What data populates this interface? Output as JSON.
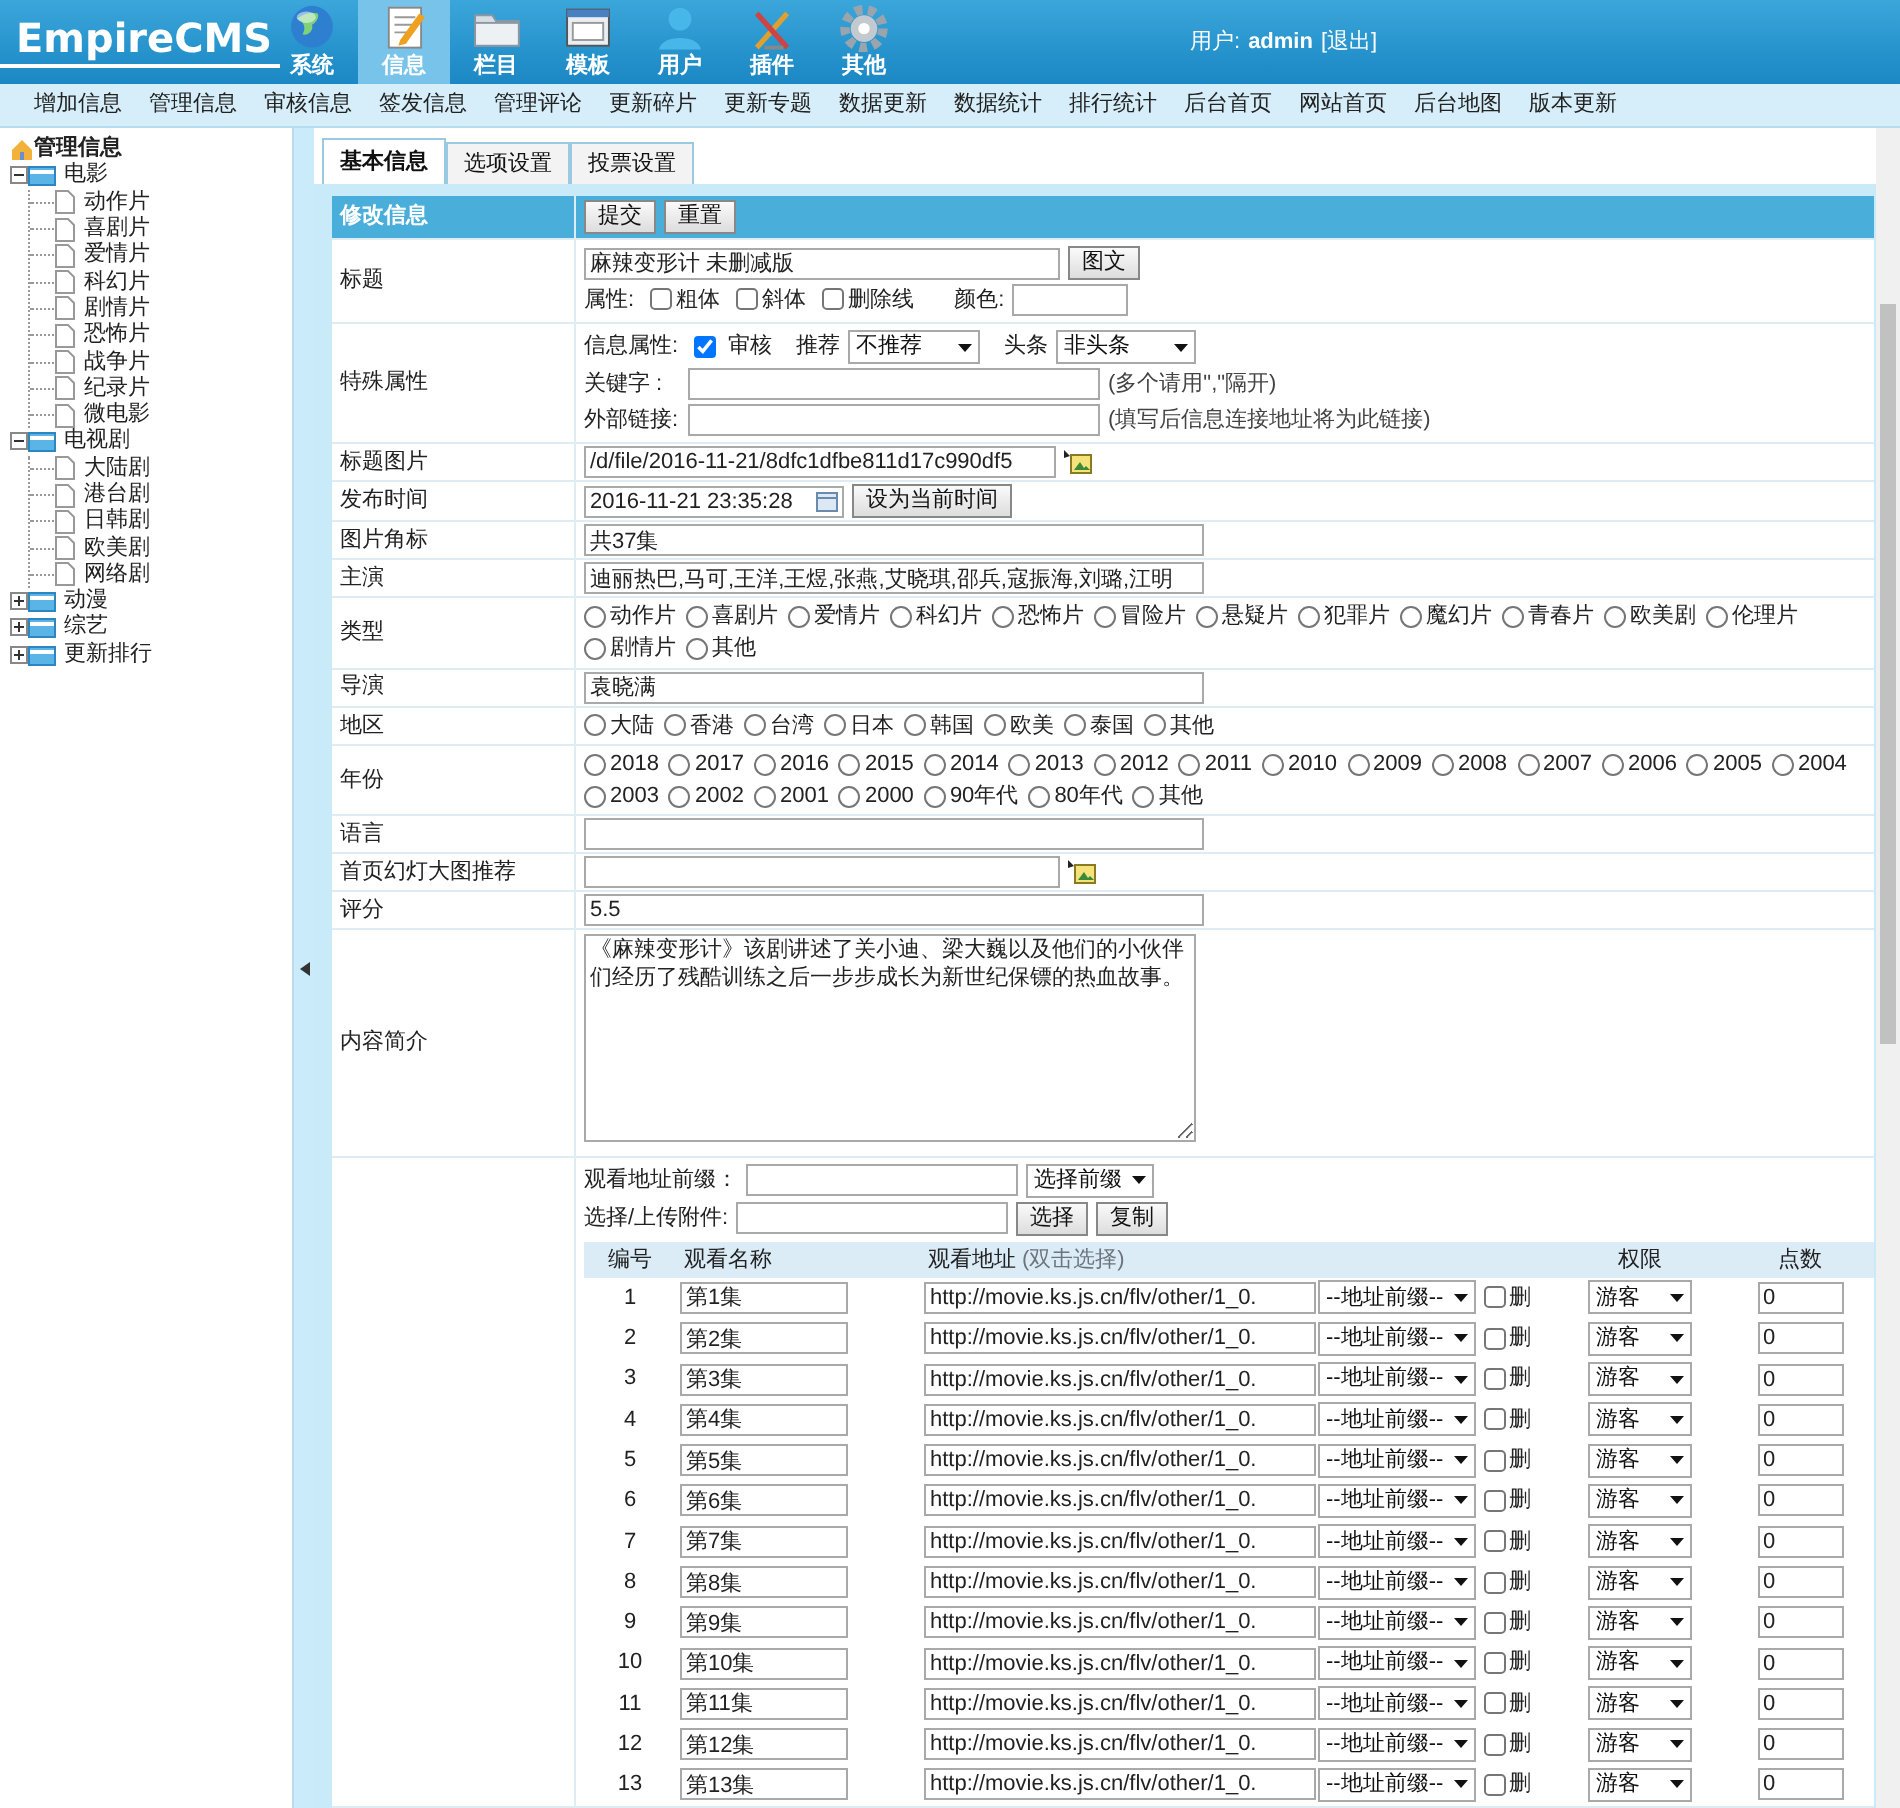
{
  "header": {
    "logo": "EmpireCMS",
    "nav": [
      {
        "label": "系统",
        "selected": false
      },
      {
        "label": "信息",
        "selected": true
      },
      {
        "label": "栏目",
        "selected": false
      },
      {
        "label": "模板",
        "selected": false
      },
      {
        "label": "用户",
        "selected": false
      },
      {
        "label": "插件",
        "selected": false
      },
      {
        "label": "其他",
        "selected": false
      }
    ],
    "user_label": "用户:",
    "user": "admin",
    "logout": "[退出]"
  },
  "submenu": [
    "增加信息",
    "管理信息",
    "审核信息",
    "签发信息",
    "管理评论",
    "更新碎片",
    "更新专题",
    "数据更新",
    "数据统计",
    "排行统计",
    "后台首页",
    "网站首页",
    "后台地图",
    "版本更新"
  ],
  "sidebar": {
    "title": "管理信息",
    "items": [
      {
        "label": "电影",
        "expanded": true,
        "children": [
          {
            "label": "动作片"
          },
          {
            "label": "喜剧片"
          },
          {
            "label": "爱情片"
          },
          {
            "label": "科幻片"
          },
          {
            "label": "剧情片"
          },
          {
            "label": "恐怖片"
          },
          {
            "label": "战争片"
          },
          {
            "label": "纪录片"
          },
          {
            "label": "微电影"
          }
        ]
      },
      {
        "label": "电视剧",
        "expanded": true,
        "children": [
          {
            "label": "大陆剧"
          },
          {
            "label": "港台剧"
          },
          {
            "label": "日韩剧"
          },
          {
            "label": "欧美剧"
          },
          {
            "label": "网络剧"
          }
        ]
      },
      {
        "label": "动漫",
        "expanded": false
      },
      {
        "label": "综艺",
        "expanded": false
      },
      {
        "label": "更新排行",
        "expanded": false
      }
    ]
  },
  "tabs": [
    {
      "label": "基本信息",
      "selected": true
    },
    {
      "label": "选项设置",
      "selected": false
    },
    {
      "label": "投票设置",
      "selected": false
    }
  ],
  "form": {
    "heading": "修改信息",
    "buttons": [
      "提交",
      "重置"
    ],
    "fields": [
      {
        "kind": "title",
        "label": "标题",
        "value": "麻辣变形计 未删减版",
        "button": "图文",
        "attr_label": "属性:",
        "options": [
          {
            "label": "粗体",
            "checked": false
          },
          {
            "label": "斜体",
            "checked": false
          },
          {
            "label": "删除线",
            "checked": false
          }
        ],
        "color_label": "颜色:"
      },
      {
        "kind": "special",
        "label": "特殊属性",
        "info_label": "信息属性:",
        "audit": {
          "label": "审核",
          "checked": true
        },
        "recommend_label": "推荐",
        "recommend_value": "不推荐",
        "headline_label": "头条",
        "headline_value": "非头条",
        "keyword_label": "关键字 :",
        "keyword_hint": "(多个请用\",\"隔开)",
        "link_label": "外部链接:",
        "link_hint": "(填写后信息连接地址将为此链接)"
      },
      {
        "kind": "image",
        "label": "标题图片",
        "value": "/d/file/2016-11-21/8dfc1dfbe811d17c990df5"
      },
      {
        "kind": "datetime",
        "label": "发布时间",
        "value": "2016-11-21 23:35:28",
        "button": "设为当前时间"
      },
      {
        "kind": "text",
        "label": "图片角标",
        "value": "共37集"
      },
      {
        "kind": "text",
        "label": "主演",
        "value": "迪丽热巴,马可,王洋,王煜,张燕,艾晓琪,邵兵,寇振海,刘璐,江明"
      },
      {
        "kind": "radio",
        "label": "类型",
        "options": [
          {
            "label": "动作片",
            "selected": false
          },
          {
            "label": "喜剧片",
            "selected": false
          },
          {
            "label": "爱情片",
            "selected": false
          },
          {
            "label": "科幻片",
            "selected": false
          },
          {
            "label": "恐怖片",
            "selected": false
          },
          {
            "label": "冒险片",
            "selected": false
          },
          {
            "label": "悬疑片",
            "selected": false
          },
          {
            "label": "犯罪片",
            "selected": false
          },
          {
            "label": "魔幻片",
            "selected": false
          },
          {
            "label": "青春片",
            "selected": false
          },
          {
            "label": "欧美剧",
            "selected": false
          },
          {
            "label": "伦理片",
            "selected": false
          },
          {
            "label": "剧情片",
            "selected": false
          },
          {
            "label": "其他",
            "selected": false
          }
        ]
      },
      {
        "kind": "text",
        "label": "导演",
        "value": "袁晓满"
      },
      {
        "kind": "radio",
        "label": "地区",
        "options": [
          {
            "label": "大陆",
            "selected": false
          },
          {
            "label": "香港",
            "selected": false
          },
          {
            "label": "台湾",
            "selected": false
          },
          {
            "label": "日本",
            "selected": false
          },
          {
            "label": "韩国",
            "selected": false
          },
          {
            "label": "欧美",
            "selected": false
          },
          {
            "label": "泰国",
            "selected": false
          },
          {
            "label": "其他",
            "selected": false
          }
        ]
      },
      {
        "kind": "radio",
        "label": "年份",
        "options": [
          {
            "label": "2018",
            "selected": false
          },
          {
            "label": "2017",
            "selected": false
          },
          {
            "label": "2016",
            "selected": false
          },
          {
            "label": "2015",
            "selected": false
          },
          {
            "label": "2014",
            "selected": false
          },
          {
            "label": "2013",
            "selected": false
          },
          {
            "label": "2012",
            "selected": false
          },
          {
            "label": "2011",
            "selected": false
          },
          {
            "label": "2010",
            "selected": false
          },
          {
            "label": "2009",
            "selected": false
          },
          {
            "label": "2008",
            "selected": false
          },
          {
            "label": "2007",
            "selected": false
          },
          {
            "label": "2006",
            "selected": false
          },
          {
            "label": "2005",
            "selected": false
          },
          {
            "label": "2004",
            "selected": false
          },
          {
            "label": "2003",
            "selected": false
          },
          {
            "label": "2002",
            "selected": false
          },
          {
            "label": "2001",
            "selected": false
          },
          {
            "label": "2000",
            "selected": false
          },
          {
            "label": "90年代",
            "selected": false
          },
          {
            "label": "80年代",
            "selected": false
          },
          {
            "label": "其他",
            "selected": false
          }
        ]
      },
      {
        "kind": "text",
        "label": "语言"
      },
      {
        "kind": "image_short",
        "label": "首页幻灯大图推荐"
      },
      {
        "kind": "text",
        "label": "评分",
        "value": "5.5"
      },
      {
        "kind": "textarea",
        "label": "内容简介",
        "value": "《麻辣变形计》该剧讲述了关小迪、梁大巍以及他们的小伙伴们经历了残酷训练之后一步步成长为新世纪保镖的热血故事。"
      }
    ]
  },
  "episodes": {
    "prefix_label": "观看地址前缀：",
    "prefix_select": "选择前缀",
    "attach_label": "选择/上传附件:",
    "buttons": [
      "选择",
      "复制"
    ],
    "columns": [
      {
        "label": "编号"
      },
      {
        "label": "观看名称"
      },
      {
        "label": "观看地址",
        "hint": "(双击选择)"
      },
      {
        "label": "权限"
      },
      {
        "label": "点数"
      }
    ],
    "rows": [
      {
        "no": "1",
        "name": "第1集",
        "url": "http://movie.ks.js.cn/flv/other/1_0.",
        "prefix": "--地址前缀--",
        "delete_label": "删",
        "delete": false,
        "permission": "游客",
        "points": "0"
      },
      {
        "no": "2",
        "name": "第2集",
        "url": "http://movie.ks.js.cn/flv/other/1_0.",
        "prefix": "--地址前缀--",
        "delete_label": "删",
        "delete": false,
        "permission": "游客",
        "points": "0"
      },
      {
        "no": "3",
        "name": "第3集",
        "url": "http://movie.ks.js.cn/flv/other/1_0.",
        "prefix": "--地址前缀--",
        "delete_label": "删",
        "delete": false,
        "permission": "游客",
        "points": "0"
      },
      {
        "no": "4",
        "name": "第4集",
        "url": "http://movie.ks.js.cn/flv/other/1_0.",
        "prefix": "--地址前缀--",
        "delete_label": "删",
        "delete": false,
        "permission": "游客",
        "points": "0"
      },
      {
        "no": "5",
        "name": "第5集",
        "url": "http://movie.ks.js.cn/flv/other/1_0.",
        "prefix": "--地址前缀--",
        "delete_label": "删",
        "delete": false,
        "permission": "游客",
        "points": "0"
      },
      {
        "no": "6",
        "name": "第6集",
        "url": "http://movie.ks.js.cn/flv/other/1_0.",
        "prefix": "--地址前缀--",
        "delete_label": "删",
        "delete": false,
        "permission": "游客",
        "points": "0"
      },
      {
        "no": "7",
        "name": "第7集",
        "url": "http://movie.ks.js.cn/flv/other/1_0.",
        "prefix": "--地址前缀--",
        "delete_label": "删",
        "delete": false,
        "permission": "游客",
        "points": "0"
      },
      {
        "no": "8",
        "name": "第8集",
        "url": "http://movie.ks.js.cn/flv/other/1_0.",
        "prefix": "--地址前缀--",
        "delete_label": "删",
        "delete": false,
        "permission": "游客",
        "points": "0"
      },
      {
        "no": "9",
        "name": "第9集",
        "url": "http://movie.ks.js.cn/flv/other/1_0.",
        "prefix": "--地址前缀--",
        "delete_label": "删",
        "delete": false,
        "permission": "游客",
        "points": "0"
      },
      {
        "no": "10",
        "name": "第10集",
        "url": "http://movie.ks.js.cn/flv/other/1_0.",
        "prefix": "--地址前缀--",
        "delete_label": "删",
        "delete": false,
        "permission": "游客",
        "points": "0"
      },
      {
        "no": "11",
        "name": "第11集",
        "url": "http://movie.ks.js.cn/flv/other/1_0.",
        "prefix": "--地址前缀--",
        "delete_label": "删",
        "delete": false,
        "permission": "游客",
        "points": "0"
      },
      {
        "no": "12",
        "name": "第12集",
        "url": "http://movie.ks.js.cn/flv/other/1_0.",
        "prefix": "--地址前缀--",
        "delete_label": "删",
        "delete": false,
        "permission": "游客",
        "points": "0"
      },
      {
        "no": "13",
        "name": "第13集",
        "url": "http://movie.ks.js.cn/flv/other/1_0.",
        "prefix": "--地址前缀--",
        "delete_label": "删",
        "delete": false,
        "permission": "游客",
        "points": "0"
      }
    ]
  }
}
